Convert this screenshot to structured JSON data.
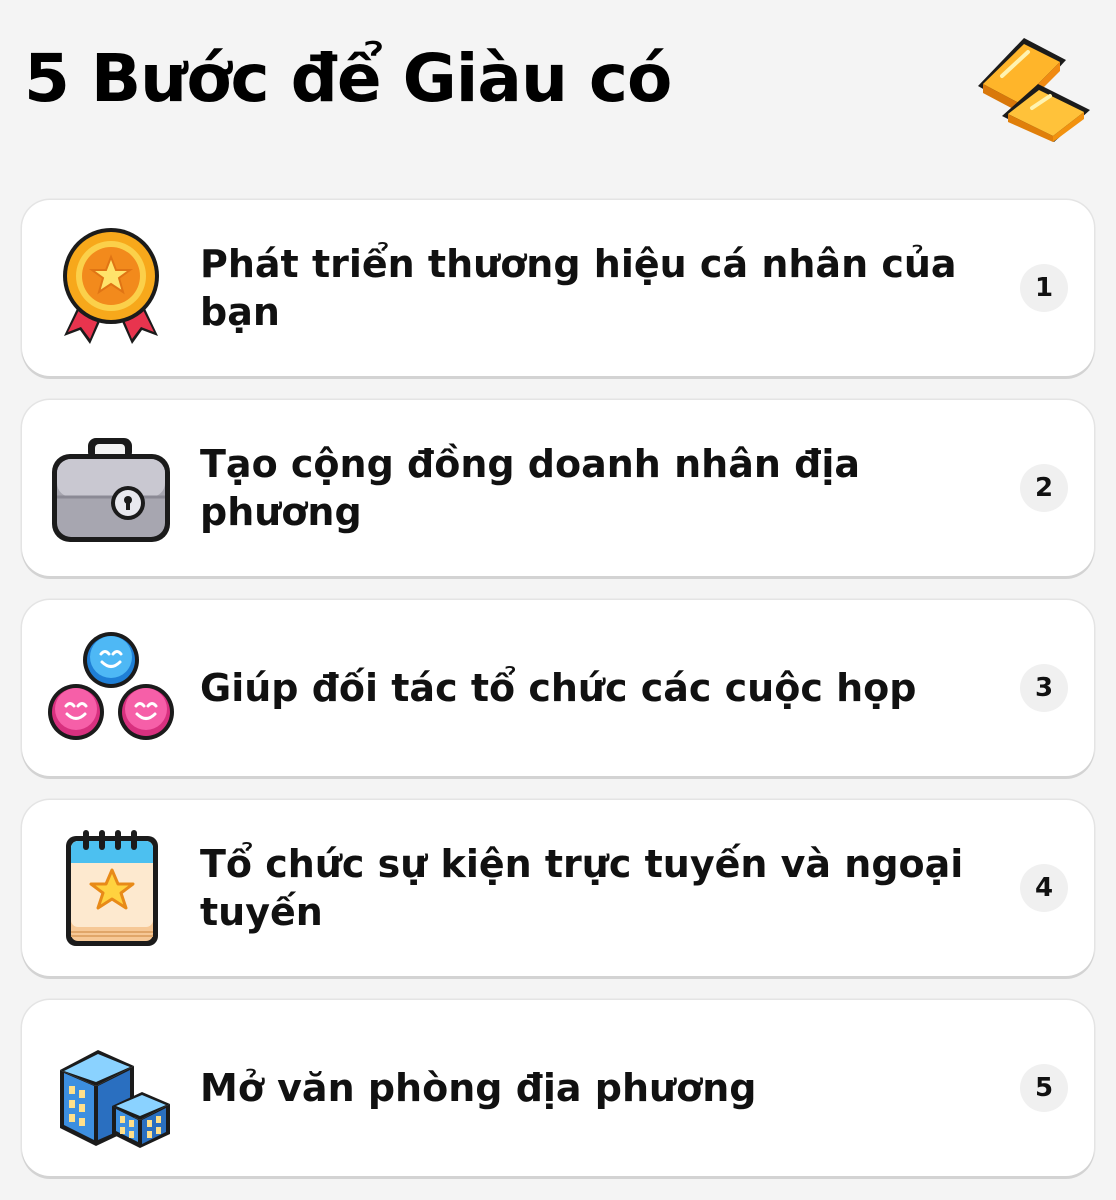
{
  "header": {
    "title": "5 Bước để Giàu có",
    "icon": "gold-bars-icon"
  },
  "steps": [
    {
      "label": "Phát triển thương hiệu cá nhân của bạn",
      "number": "1",
      "icon": "medal-icon"
    },
    {
      "label": "Tạo cộng đồng doanh nhân địa phương",
      "number": "2",
      "icon": "briefcase-icon"
    },
    {
      "label": "Giúp đối tác tổ chức các cuộc họp",
      "number": "3",
      "icon": "smiley-group-icon"
    },
    {
      "label": "Tổ chức sự kiện trực tuyến và ngoại tuyến",
      "number": "4",
      "icon": "calendar-star-icon"
    },
    {
      "label": "Mở văn phòng địa phương",
      "number": "5",
      "icon": "office-buildings-icon"
    }
  ],
  "colors": {
    "background": "#f4f4f4",
    "card": "#ffffff",
    "gold": "#f7a81b",
    "medal_ribbon": "#e8344e",
    "smiley_blue": "#3aa8ef",
    "smiley_pink": "#f04f9a",
    "building_blue": "#3d8fe0"
  }
}
